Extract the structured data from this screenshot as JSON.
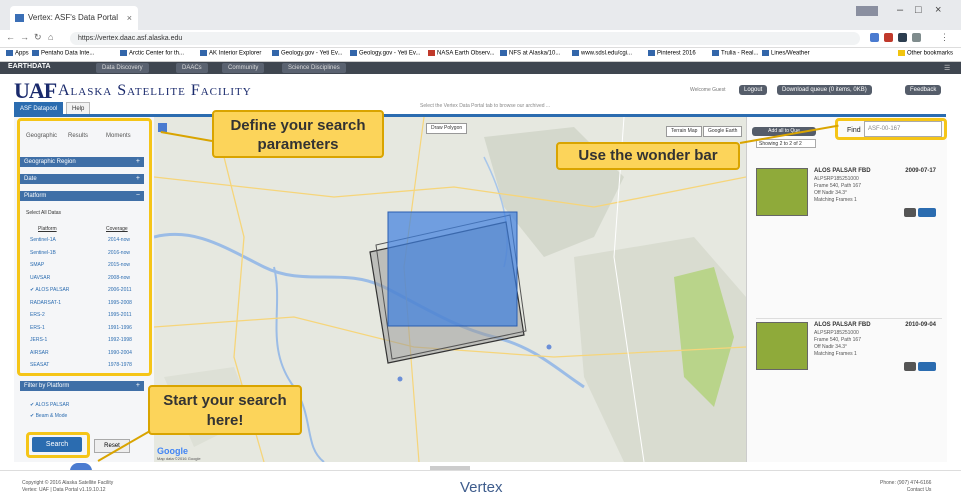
{
  "browser": {
    "tab_title": "Vertex: ASF's Data Portal",
    "url": "https://vertex.daac.asf.alaska.edu",
    "bookmarks": [
      "Apps",
      "Pentaho Data Inte...",
      "Arctic Center for th...",
      "AK Interior Explorer",
      "Geology.gov - Yeti Ev...",
      "Geology.gov - Yeti Ev...",
      "NASA Earth Observ...",
      "NFS at Alaska/10...",
      "www.sdsl.edu/cgi...",
      "Pinterest 2016",
      "Trulia - Real...",
      "Lines/Weather",
      "Other bookmarks"
    ]
  },
  "site_nav": {
    "logo": "EARTHDATA",
    "items": [
      "Data Discovery",
      "DAACs",
      "Community",
      "Science Disciplines"
    ]
  },
  "header": {
    "uaf": "UAF",
    "title": "Alaska Satellite Facility",
    "welcome": "Welcome Guest",
    "logout": "Logout",
    "download_queue": "Download queue (0 items, 0KB)",
    "feedback": "Feedback",
    "info": "Select the Vertex Data Portal tab to browse our archived ..."
  },
  "app_tabs": [
    "ASF Datapool",
    "Help"
  ],
  "left_panel": {
    "subtabs": [
      "Geographic",
      "Results",
      "Moments"
    ],
    "sections": [
      "Geographic Region",
      "Date",
      "Platform"
    ],
    "select_all": "Select All Datas",
    "col_platform": "Platform",
    "col_coverage": "Coverage",
    "platforms": [
      {
        "name": "Sentinel-1A",
        "coverage": "2014-now"
      },
      {
        "name": "Sentinel-1B",
        "coverage": "2016-now"
      },
      {
        "name": "SMAP",
        "coverage": "2015-now"
      },
      {
        "name": "UAVSAR",
        "coverage": "2008-now"
      },
      {
        "name": "ALOS PALSAR",
        "coverage": "2006-2011",
        "checked": true
      },
      {
        "name": "RADARSAT-1",
        "coverage": "1995-2008"
      },
      {
        "name": "ERS-2",
        "coverage": "1995-2011"
      },
      {
        "name": "ERS-1",
        "coverage": "1991-1996"
      },
      {
        "name": "JERS-1",
        "coverage": "1992-1998"
      },
      {
        "name": "AIRSAR",
        "coverage": "1990-2004"
      },
      {
        "name": "SEASAT",
        "coverage": "1978-1978"
      }
    ],
    "filter_title": "Filter by Platform",
    "filter_links": [
      "ALOS PALSAR",
      "Beam & Mode"
    ],
    "search_button": "Search",
    "reset_button": "Reset"
  },
  "map": {
    "draw_button": "Draw Polygon",
    "view_buttons": [
      "Terrain Map",
      "Google Earth"
    ],
    "attribution": "Google",
    "map_data": "Map data ©2016 Google"
  },
  "right_panel": {
    "add_button": "Add all to Que",
    "find_label": "Find",
    "find_value": "ASF-00-167",
    "sort_label": "Showing 2 to 2 of 2",
    "results": [
      {
        "title": "ALOS PALSAR FBD",
        "id": "ALPSRP185251000",
        "line1": "Frame 540, Path 167",
        "line2": "Off Nadir 34.3°",
        "line3": "Matching Frames 1",
        "date": "2009-07-17"
      },
      {
        "title": "ALOS PALSAR FBD",
        "id": "ALPSRP185251000",
        "line1": "Frame 540, Path 167",
        "line2": "Off Nadir 34.3°",
        "line3": "Matching Frames 1",
        "date": "2010-09-04"
      }
    ]
  },
  "footer": {
    "brand": "Vertex",
    "copyright": "Copyright © 2016 Alaska Satellite Facility",
    "status": "Vertex: UAF | Data Portal v1.19.10.12",
    "right_line1": "Phone: (907) 474-6166",
    "right_line2": "Contact Us"
  },
  "callouts": {
    "define": "Define your search parameters",
    "wonder": "Use the wonder bar",
    "start": "Start your search here!"
  }
}
